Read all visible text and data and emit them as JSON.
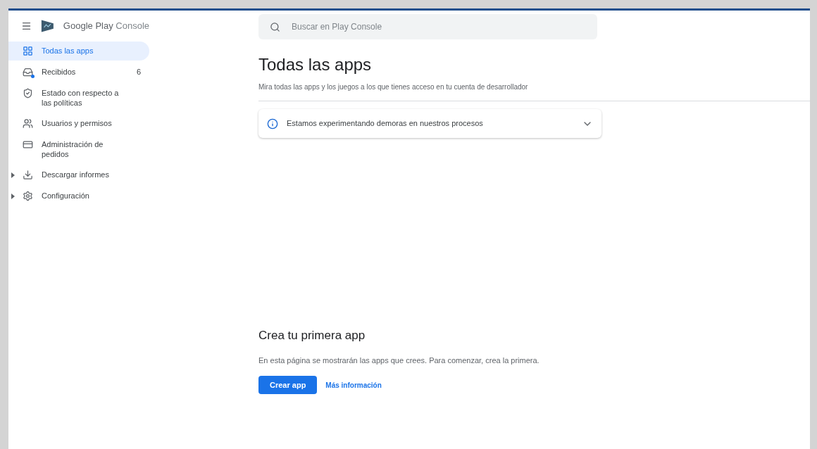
{
  "brand": {
    "name": "Google Play",
    "product": "Console"
  },
  "sidebar": {
    "items": [
      {
        "label": "Todas las apps",
        "selected": true,
        "expandable": false
      },
      {
        "label": "Recibidos",
        "selected": false,
        "expandable": false,
        "count": "6",
        "unread": true
      },
      {
        "label": "Estado con respecto a las políticas",
        "selected": false,
        "expandable": false
      },
      {
        "label": "Usuarios y permisos",
        "selected": false,
        "expandable": false
      },
      {
        "label": "Administración de pedidos",
        "selected": false,
        "expandable": false
      },
      {
        "label": "Descargar informes",
        "selected": false,
        "expandable": true
      },
      {
        "label": "Configuración",
        "selected": false,
        "expandable": true
      }
    ]
  },
  "search": {
    "placeholder": "Buscar en Play Console"
  },
  "page": {
    "title": "Todas las apps",
    "subtitle": "Mira todas las apps y los juegos a los que tienes acceso en tu cuenta de desarrollador"
  },
  "notice": {
    "text": "Estamos experimentando demoras en nuestros procesos",
    "expanded": false
  },
  "empty_state": {
    "title": "Crea tu primera app",
    "text": "En esta página se mostrarán las apps que crees. Para comenzar, crea la primera.",
    "primary_button": "Crear app",
    "link": "Más información"
  }
}
